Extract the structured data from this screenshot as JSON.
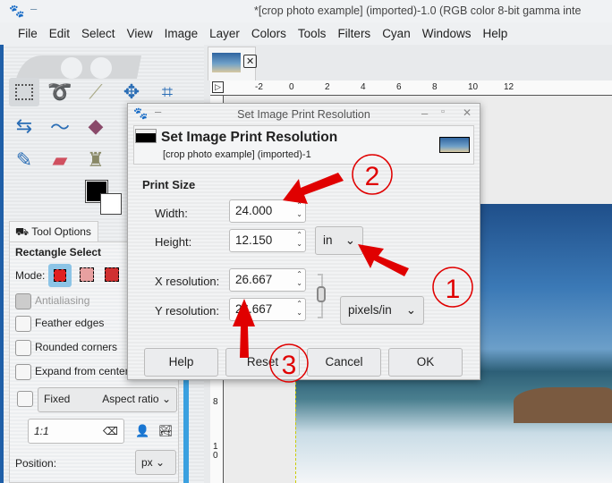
{
  "window": {
    "title": "*[crop photo example] (imported)-1.0 (RGB color 8-bit gamma inte"
  },
  "menu": [
    "File",
    "Edit",
    "Select",
    "View",
    "Image",
    "Layer",
    "Colors",
    "Tools",
    "Filters",
    "Cyan",
    "Windows",
    "Help"
  ],
  "ruler": {
    "h": [
      "-2",
      "0",
      "2",
      "4",
      "6",
      "8",
      "10",
      "12"
    ],
    "v": [
      "8",
      "1",
      "0"
    ]
  },
  "tool_options": {
    "tab": "Tool Options",
    "title": "Rectangle Select",
    "mode_label": "Mode:",
    "antialiasing": "Antialiasing",
    "feather": "Feather edges",
    "rounded": "Rounded corners",
    "expand": "Expand from center",
    "fixed": "Fixed",
    "fixed_mode": "Aspect ratio",
    "ratio": "1:1",
    "position": "Position:",
    "unit": "px"
  },
  "dialog": {
    "title": "Set Image Print Resolution",
    "heading": "Set Image Print Resolution",
    "subtitle": "[crop photo example] (imported)-1",
    "section": "Print Size",
    "width_label": "Width:",
    "width": "24.000",
    "height_label": "Height:",
    "height": "12.150",
    "size_unit": "in",
    "xres_label": "X resolution:",
    "xres": "26.667",
    "yres_label": "Y resolution:",
    "yres": "26.667",
    "res_unit": "pixels/in",
    "buttons": {
      "help": "Help",
      "reset": "Reset",
      "cancel": "Cancel",
      "ok": "OK"
    }
  },
  "annotations": {
    "n1": "1",
    "n2": "2",
    "n3": "3",
    "color": "#e00000"
  }
}
